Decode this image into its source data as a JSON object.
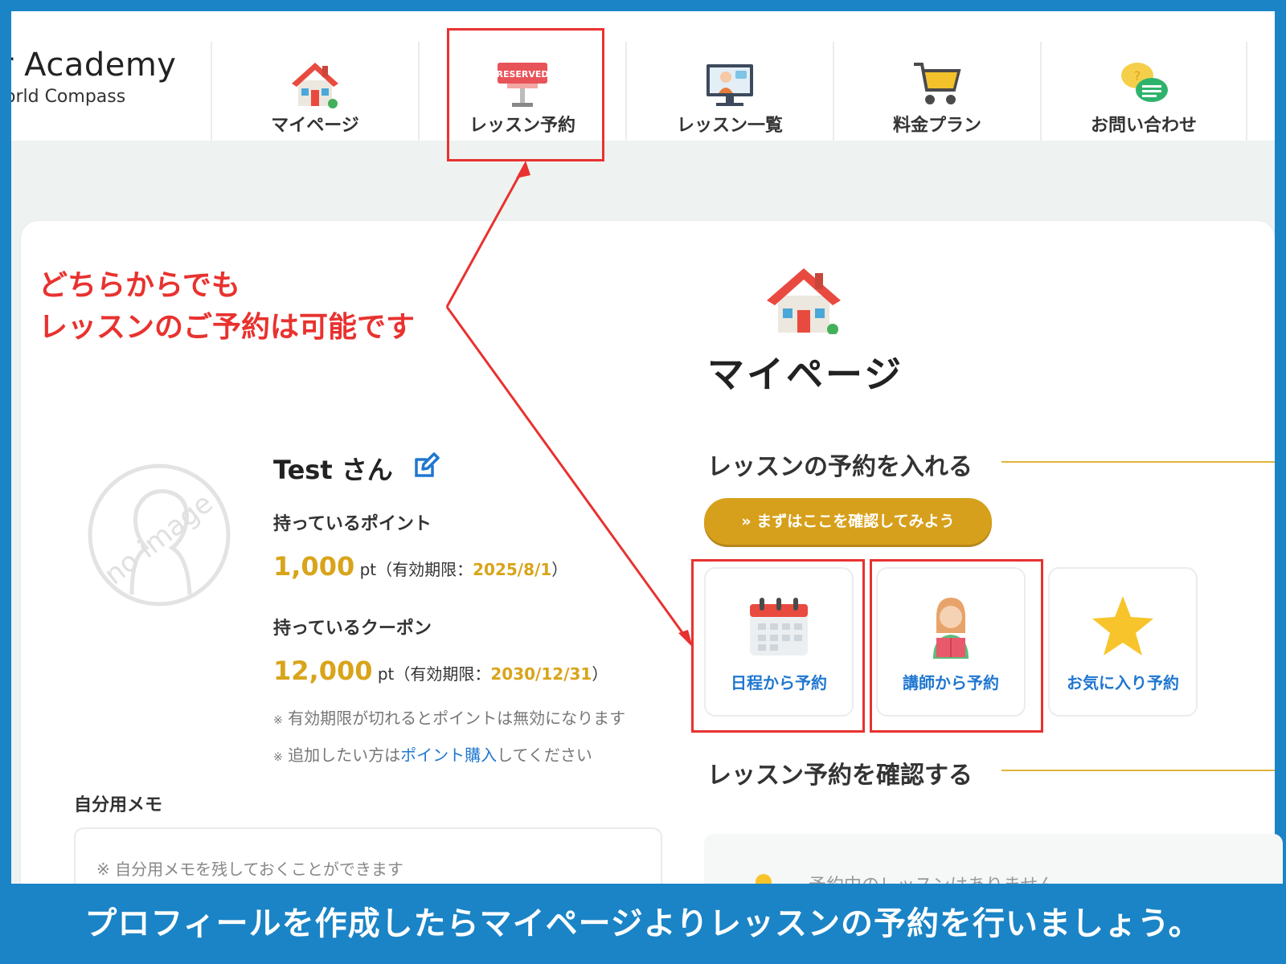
{
  "header": {
    "logo_main": "r Academy",
    "logo_sub": "orld Compass",
    "nav": [
      {
        "label": "マイページ",
        "icon": "house-icon"
      },
      {
        "label": "レッスン予約",
        "icon": "reserved-sign-icon"
      },
      {
        "label": "レッスン一覧",
        "icon": "teacher-monitor-icon"
      },
      {
        "label": "料金プラン",
        "icon": "cart-icon"
      },
      {
        "label": "お問い合わせ",
        "icon": "chat-bubbles-icon"
      }
    ],
    "reserved_text": "RESERVED"
  },
  "page": {
    "title": "マイページ",
    "avatar_text": "no image"
  },
  "profile": {
    "name": "Test さん",
    "points_label": "持っているポイント",
    "points_value": "1,000",
    "points_unit": "pt（有効期限：",
    "points_expiry": "2025/8/1",
    "points_close": "）",
    "coupon_label": "持っているクーポン",
    "coupon_value": "12,000",
    "coupon_unit": "pt（有効期限：",
    "coupon_expiry": "2030/12/31",
    "coupon_close": "）",
    "note_mark": "※",
    "note1": "有効期限が切れるとポイントは無効になります",
    "note2_prefix": "追加したい方は",
    "note2_link": "ポイント購入",
    "note2_suffix": "してください"
  },
  "memo": {
    "label": "自分用メモ",
    "placeholder": "※ 自分用メモを残しておくことができます"
  },
  "booking": {
    "heading": "レッスンの予約を入れる",
    "cta": "» まずはここを確認してみよう",
    "tiles": [
      {
        "label": "日程から予約",
        "icon": "calendar-icon"
      },
      {
        "label": "講師から予約",
        "icon": "teacher-icon"
      },
      {
        "label": "お気に入り予約",
        "icon": "star-icon"
      }
    ]
  },
  "confirm": {
    "heading": "レッスン予約を確認する",
    "empty": "予約中のレッスンはありません"
  },
  "annotation": {
    "line1": "どちらからでも",
    "line2": "レッスンのご予約は可能です"
  },
  "caption": "プロフィールを作成したらマイページよりレッスンの予約を行いましょう。",
  "colors": {
    "frame": "#1a84c6",
    "accent_gold": "#d7a01c",
    "link_blue": "#1f77d0",
    "annotation_red": "#e8322f"
  }
}
